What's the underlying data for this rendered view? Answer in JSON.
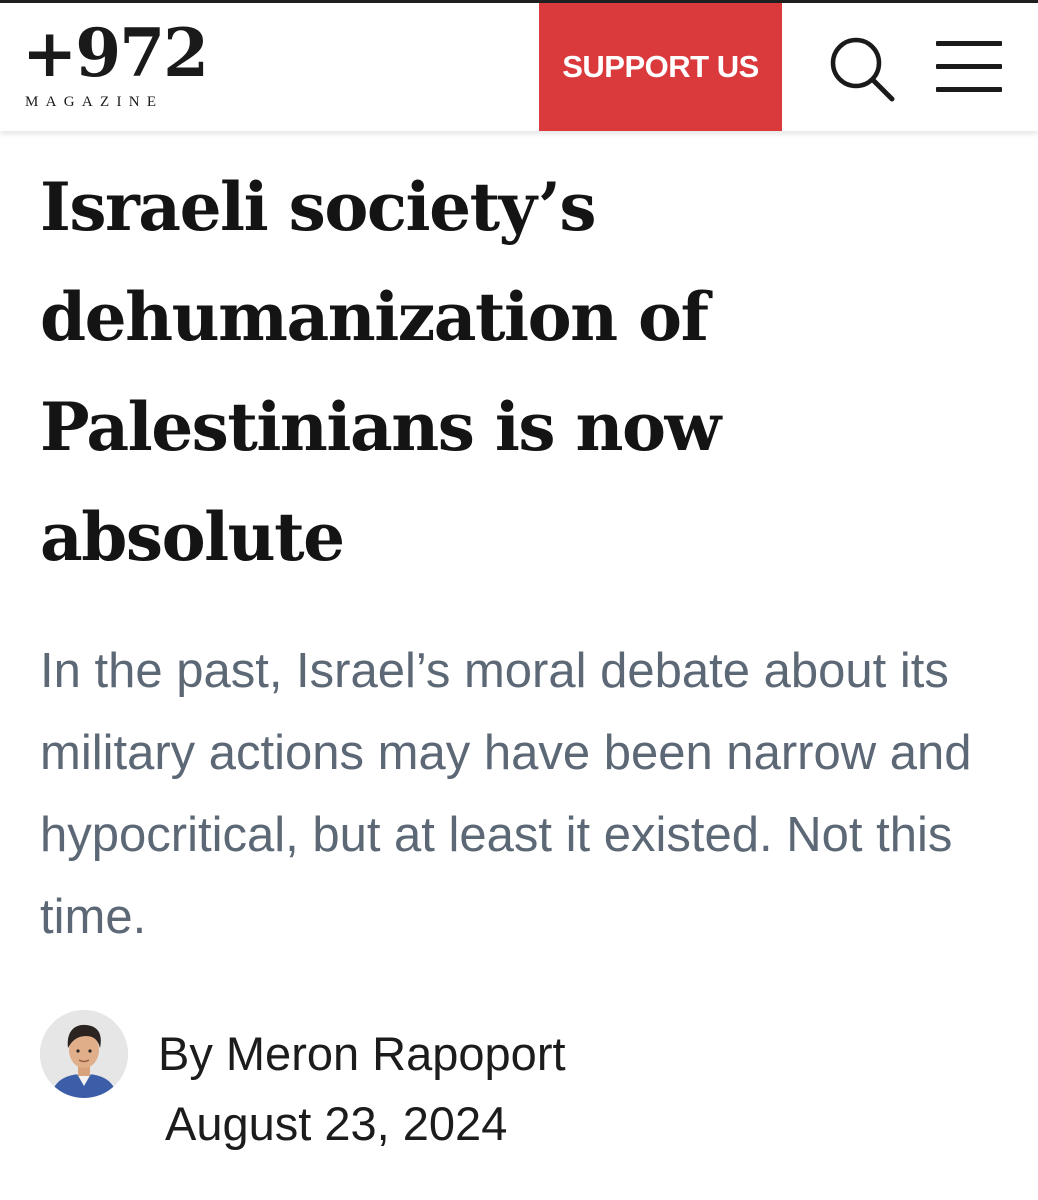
{
  "header": {
    "logo": {
      "number": "+972",
      "subtitle": "MAGAZINE"
    },
    "support_label": "SUPPORT US",
    "search_icon": "search-icon",
    "menu_icon": "hamburger-menu-icon",
    "accent_color": "#db3a3d"
  },
  "article": {
    "headline": "Israeli society’s dehumanization of Palestinians is now absolute",
    "dek": "In the past, Israel’s moral debate about its military actions may have been narrow and hypocritical, but at least it existed. Not this time.",
    "author": "By Meron Rapoport",
    "date": "August 23, 2024",
    "avatar_icon": "author-avatar"
  }
}
